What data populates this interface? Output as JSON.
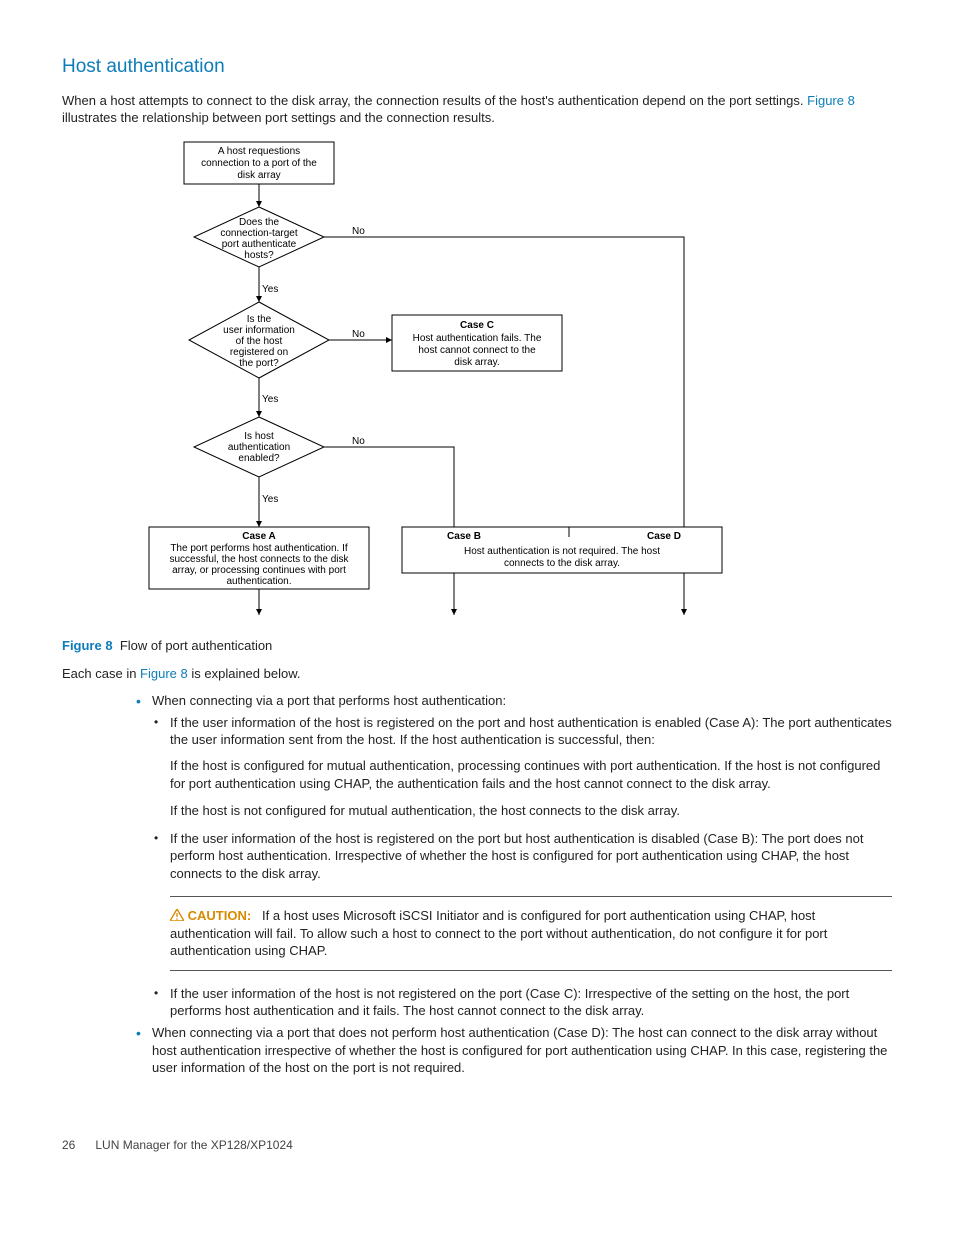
{
  "section_title": "Host authentication",
  "intro_before_fig": "When a host attempts to connect to the disk array, the connection results of the host's authentication depend on the port settings. ",
  "intro_figref": "Figure 8",
  "intro_after_fig": " illustrates the relationship between port settings and the connection results.",
  "flow": {
    "n1": [
      "A host requestions",
      "connection to a port of the",
      "disk array"
    ],
    "d1": [
      "Does the",
      "connection-target",
      "port authenticate",
      "hosts?"
    ],
    "d2": [
      "Is the",
      "user information",
      "of the host",
      "registered on",
      "the port?"
    ],
    "d3": [
      "Is host",
      "authentication",
      "enabled?"
    ],
    "caseA_t": "Case A",
    "caseA": [
      "The port performs host authentication. If",
      "successful, the host connects to the disk",
      "array, or processing continues with port",
      "authentication."
    ],
    "caseB_t": "Case B",
    "caseC_t": "Case C",
    "caseC": [
      "Host authentication fails. The",
      "host cannot connect to the",
      "disk array."
    ],
    "caseD_t": "Case D",
    "caseBD": [
      "Host authentication is not required. The host",
      "connects to the disk array."
    ],
    "yes": "Yes",
    "no": "No"
  },
  "fig_num": "Figure 8",
  "fig_cap": "Flow of port authentication",
  "after_fig_intro_pre": "Each case in ",
  "after_fig_intro_link": "Figure 8",
  "after_fig_intro_post": " is explained below.",
  "bul1a": "When connecting via a port that performs host authentication:",
  "bul2a": "If the user information of the host is registered on the port and host authentication is enabled (Case A): The port authenticates the user information sent from the host. If the host authentication is successful, then:",
  "bul2a_p1": "If the host is configured for mutual authentication, processing continues with port authentication. If the host is not configured for port authentication using CHAP, the authentication fails and the host cannot connect to the disk array.",
  "bul2a_p2": "If the host is not configured for mutual authentication, the host connects to the disk array.",
  "bul2b": "If the user information of the host is registered on the port but host authentication is disabled (Case B): The port does not perform host authentication. Irrespective of whether the host is configured for port authentication using CHAP, the host connects to the disk array.",
  "caution_label": "CAUTION:",
  "caution_text": "If a host uses Microsoft iSCSI Initiator and is configured for port authentication using CHAP, host authentication will fail. To allow such a host to connect to the port without authentication, do not configure it for port authentication using CHAP.",
  "bul2c": "If the user information of the host is not registered on the port (Case C): Irrespective of the setting on the host, the port performs host authentication and it fails. The host cannot connect to the disk array.",
  "bul1d": "When connecting via a port that does not perform host authentication (Case D): The host can connect to the disk array without host authentication irrespective of whether the host is configured for port authentication using CHAP. In this case, registering the user information of the host on the port is not required.",
  "footer_page": "26",
  "footer_text": "LUN Manager for the XP128/XP1024"
}
